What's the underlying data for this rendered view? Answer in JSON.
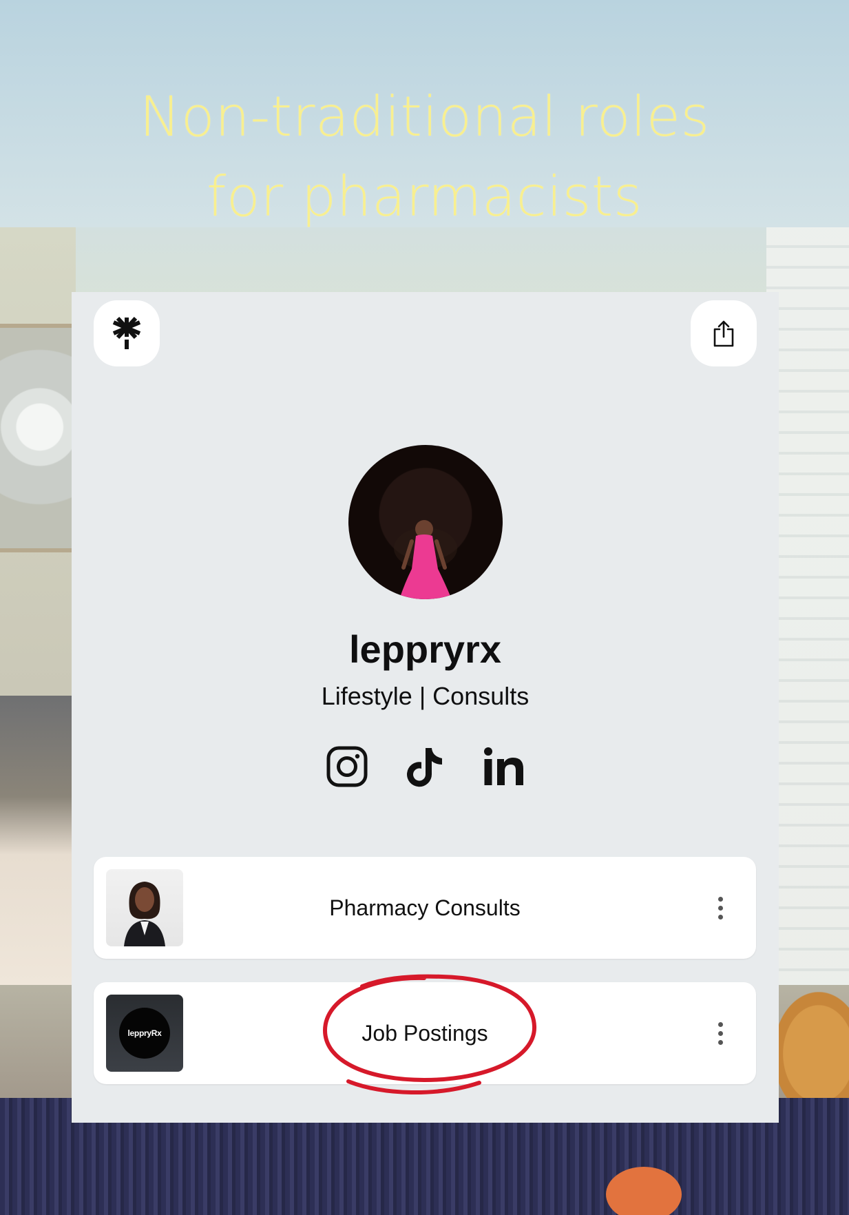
{
  "headline": {
    "line1": "Non-traditional roles",
    "line2": "for pharmacists"
  },
  "card": {
    "logo_icon": "linktree-asterisk-icon",
    "share_icon": "share-icon",
    "profile": {
      "username": "leppryrx",
      "bio": "Lifestyle | Consults"
    },
    "socials": [
      "instagram-icon",
      "tiktok-icon",
      "linkedin-icon"
    ],
    "links": [
      {
        "label": "Pharmacy Consults",
        "thumbnail": "portrait"
      },
      {
        "label": "Job Postings",
        "thumbnail": "logo",
        "thumbnail_text": "leppryRx"
      }
    ]
  },
  "colors": {
    "headline": "#f8ef90",
    "card_bg": "#e8ebed",
    "annotation_circle": "#d6192a"
  }
}
